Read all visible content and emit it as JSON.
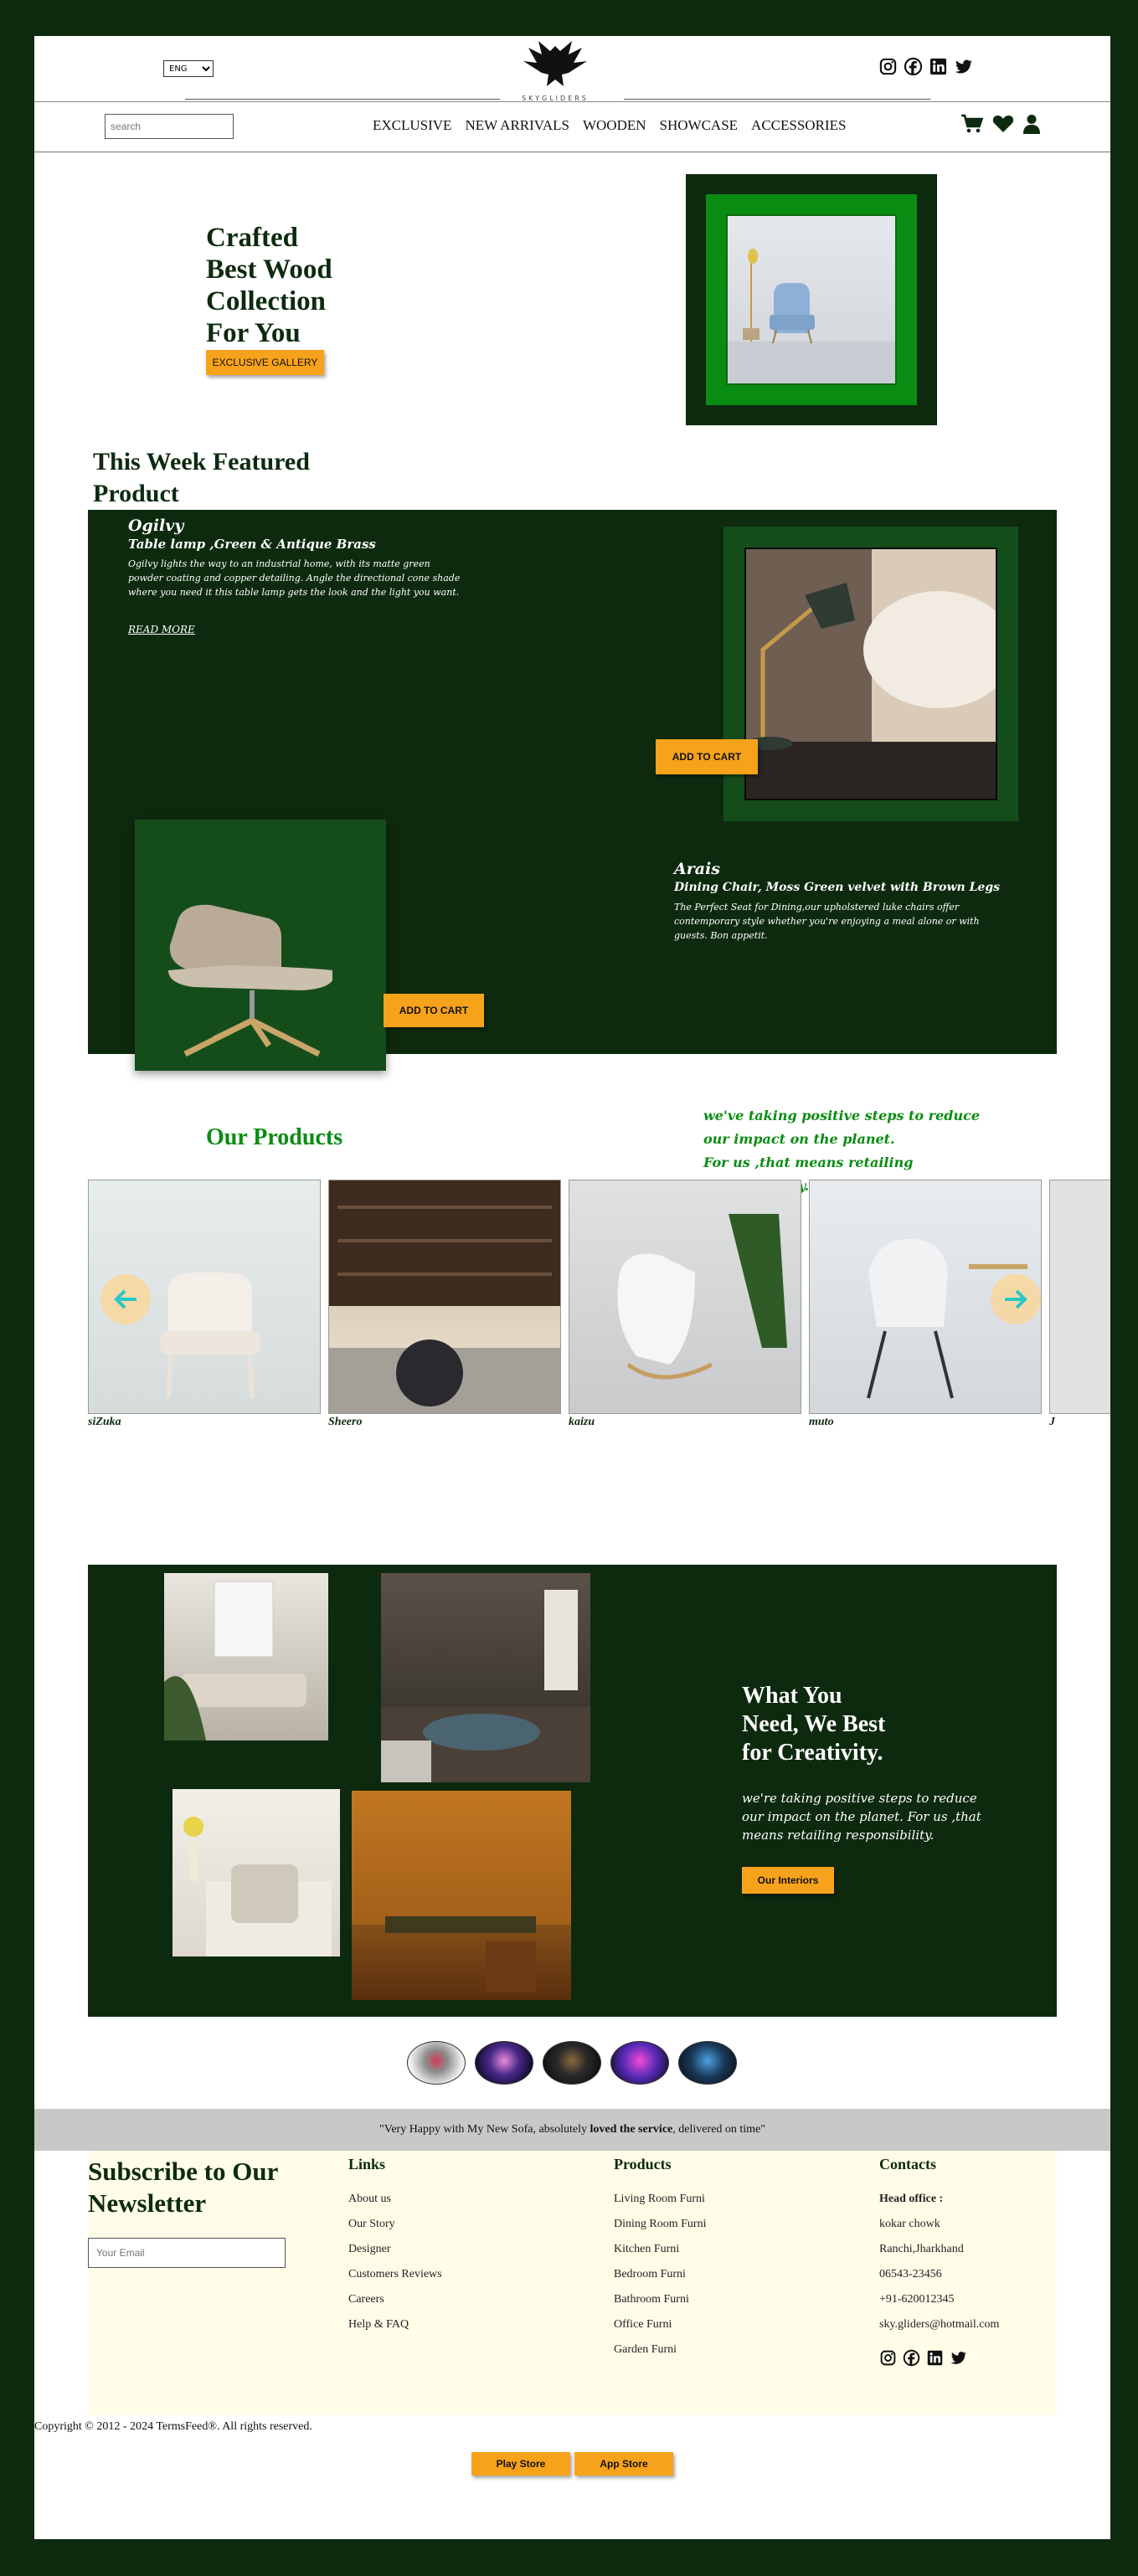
{
  "header": {
    "language": "ENG",
    "brand": "SKYGLIDERS",
    "search_placeholder": "search",
    "nav": [
      "EXCLUSIVE",
      "NEW ARRIVALS",
      "WOODEN",
      "SHOWCASE",
      "ACCESSORIES"
    ],
    "social_icons": [
      "instagram-icon",
      "facebook-icon",
      "linkedin-icon",
      "twitter-icon"
    ],
    "action_icons": [
      "cart-icon",
      "heart-icon",
      "user-icon"
    ]
  },
  "hero": {
    "title_lines": [
      "Crafted",
      "Best Wood",
      "Collection",
      "For You"
    ],
    "button": "EXCLUSIVE GALLERY"
  },
  "featured": {
    "title_lines": [
      "This Week Featured",
      "Product"
    ],
    "item1": {
      "brand": "Ogilvy",
      "name": "Table lamp ,Green & Antique Brass",
      "description": "Ogilvy lights the way to an industrial home, with its matte green powder coating and copper detailing. Angle the directional cone shade where you need it this table lamp gets the look and the light you want.",
      "link": "READ MORE",
      "button": "ADD TO CART"
    },
    "item2": {
      "brand": "Arais",
      "name": "Dining Chair, Moss Green velvet with Brown Legs",
      "description": "The Perfect Seat for Dining,our upholstered luke chairs offer contemporary style whether you're enjoying a meal alone or with guests. Bon appetit.",
      "button": "ADD TO CART"
    }
  },
  "products": {
    "title": "Our Products",
    "quote_lines": [
      "we've taking positive steps to reduce",
      "our impact on the planet.",
      "For us ,that means retailing responsibility."
    ],
    "items": [
      "siZuka",
      "Sheero",
      "kaizu",
      "muto",
      "J"
    ]
  },
  "creative": {
    "title_lines": [
      "What You",
      "Need, We Best",
      "for Creativity."
    ],
    "text": "we're taking positive steps to reduce our impact on the planet. For us ,that means retailing responsibility.",
    "button": "Our Interiors"
  },
  "testimonial": {
    "before": "\"Very Happy with My New Sofa, absolutely ",
    "bold": "loved the service",
    "after": ", delivered on time\""
  },
  "footer": {
    "newsletter_lines": [
      "Subscribe to Our",
      "Newsletter"
    ],
    "email_placeholder": "Your Email",
    "links_title": "Links",
    "links": [
      "About us",
      "Our Story",
      "Designer",
      "Customers Reviews",
      "Careers",
      "Help & FAQ"
    ],
    "products_title": "Products",
    "products": [
      "Living Room Furni",
      "Dining Room Furni",
      "Kitchen Furni",
      "Bedroom Furni",
      "Bathroom Furni",
      "Office Furni",
      "Garden Furni"
    ],
    "contacts_title": "Contacts",
    "head_office": "Head office :",
    "contacts": [
      "kokar chowk",
      "Ranchi,Jharkhand",
      "06543-23456",
      "+91-620012345",
      "sky.gliders@hotmail.com"
    ]
  },
  "copyright": "Copyright © 2012 - 2024 TermsFeed®. All rights reserved.",
  "stores": [
    "Play Store",
    "App Store"
  ],
  "colors": {
    "dark_green": "#0d2a0f",
    "bright_green": "#0a8c12",
    "orange": "#f7a21b",
    "cream": "#fffde8"
  }
}
